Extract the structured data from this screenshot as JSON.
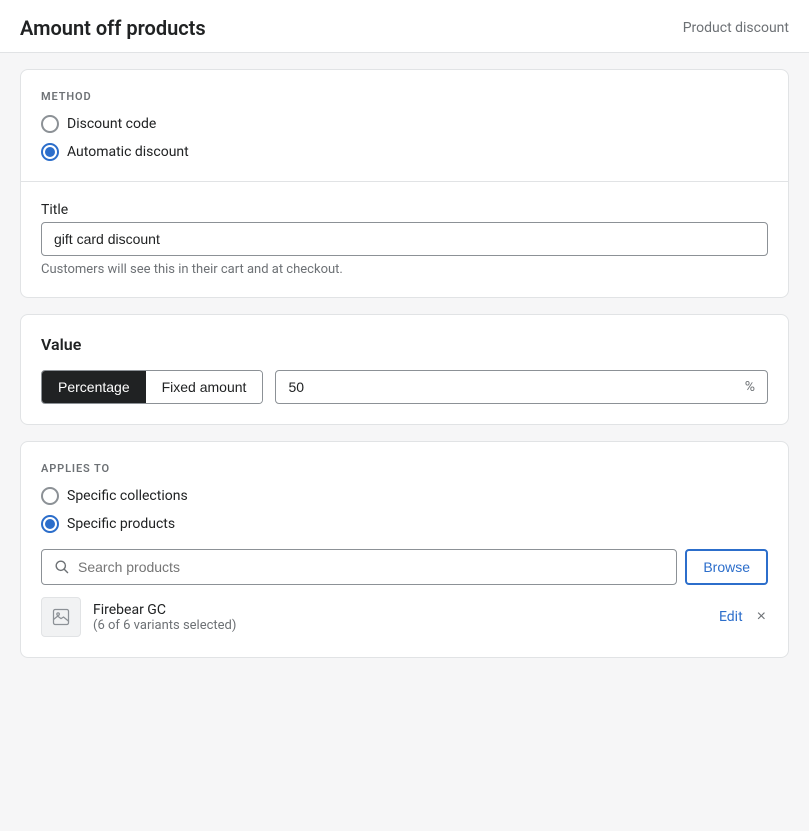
{
  "header": {
    "title": "Amount off products",
    "subtitle": "Product discount"
  },
  "method_section": {
    "label": "METHOD",
    "options": [
      {
        "id": "discount_code",
        "label": "Discount code",
        "checked": false
      },
      {
        "id": "automatic_discount",
        "label": "Automatic discount",
        "checked": true
      }
    ]
  },
  "title_field": {
    "label": "Title",
    "value": "gift card discount",
    "placeholder": "Title",
    "help_text": "Customers will see this in their cart and at checkout."
  },
  "value_section": {
    "heading": "Value",
    "toggle_options": [
      {
        "id": "percentage",
        "label": "Percentage",
        "active": true
      },
      {
        "id": "fixed_amount",
        "label": "Fixed amount",
        "active": false
      }
    ],
    "amount_value": "50",
    "amount_suffix": "%"
  },
  "applies_to_section": {
    "label": "APPLIES TO",
    "options": [
      {
        "id": "specific_collections",
        "label": "Specific collections",
        "checked": false
      },
      {
        "id": "specific_products",
        "label": "Specific products",
        "checked": true
      }
    ],
    "search_placeholder": "Search products",
    "browse_label": "Browse"
  },
  "product_item": {
    "name": "Firebear GC",
    "variants": "(6 of 6 variants selected)",
    "edit_label": "Edit",
    "remove_label": "×"
  }
}
